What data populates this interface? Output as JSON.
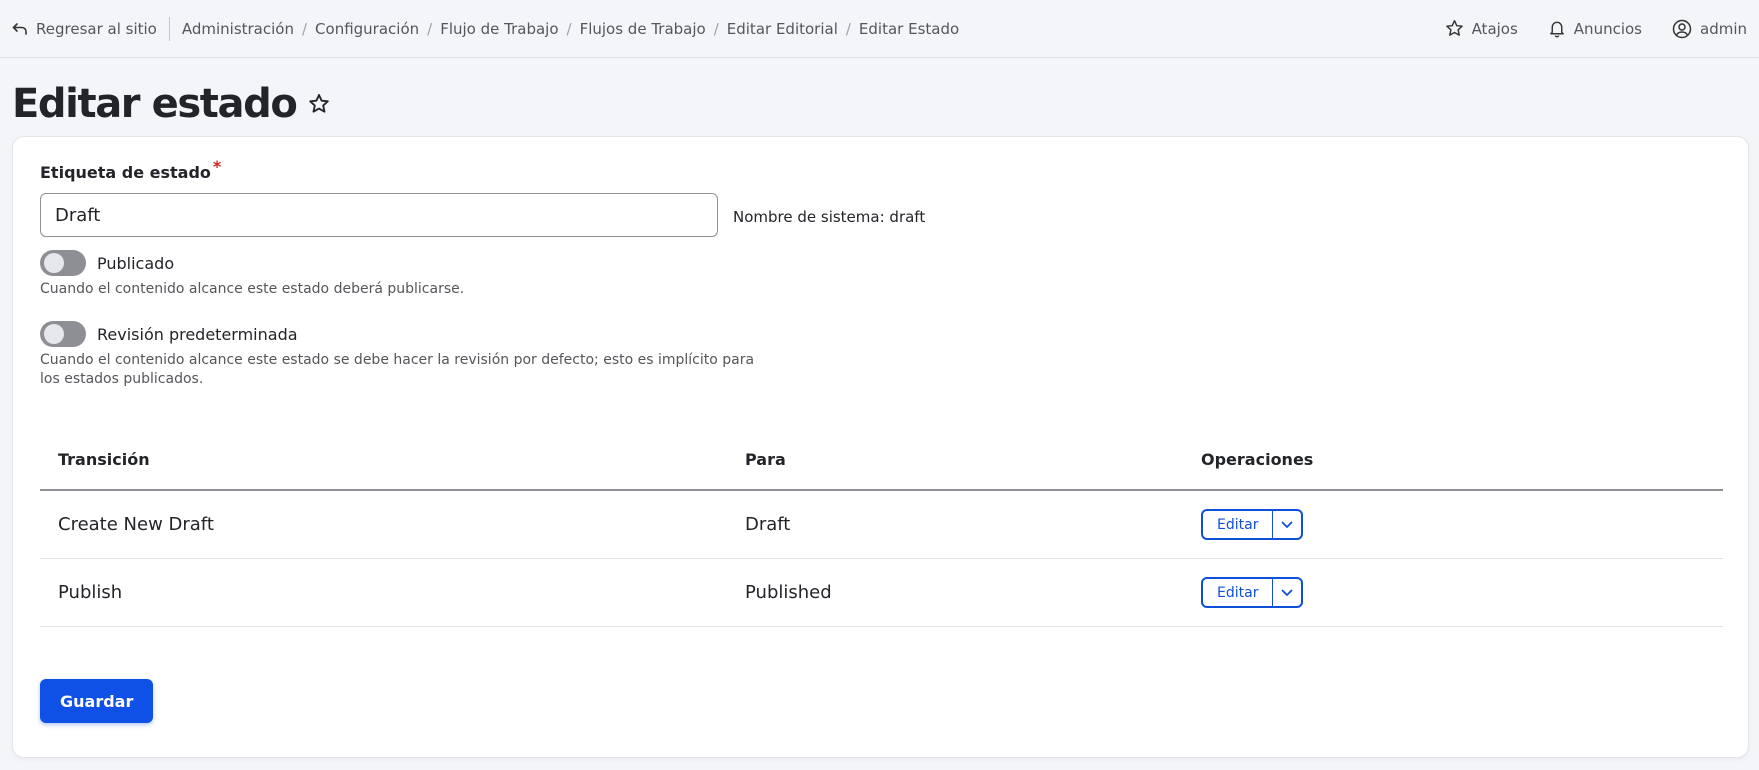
{
  "toolbar": {
    "back_label": "Regresar al sitio",
    "breadcrumbs": [
      "Administración",
      "Configuración",
      "Flujo de Trabajo",
      "Flujos de Trabajo",
      "Editar Editorial",
      "Editar Estado"
    ],
    "shortcuts_label": "Atajos",
    "announcements_label": "Anuncios",
    "user_label": "admin"
  },
  "page": {
    "title": "Editar estado"
  },
  "form": {
    "label_field": {
      "label": "Etiqueta de estado",
      "required_mark": "*",
      "value": "Draft"
    },
    "machine_name": "Nombre de sistema: draft",
    "published": {
      "label": "Publicado",
      "checked": false,
      "help": "Cuando el contenido alcance este estado deberá publicarse."
    },
    "default_revision": {
      "label": "Revisión predeterminada",
      "checked": false,
      "help": "Cuando el contenido alcance este estado se debe hacer la revisión por defecto; esto es implícito para los estados publicados."
    },
    "table": {
      "headers": [
        "Transición",
        "Para",
        "Operaciones"
      ],
      "rows": [
        {
          "transition": "Create New Draft",
          "to": "Draft",
          "operation": "Editar"
        },
        {
          "transition": "Publish",
          "to": "Published",
          "operation": "Editar"
        }
      ]
    },
    "save_label": "Guardar"
  },
  "colors": {
    "primary": "#0f50e6",
    "required": "#d72222"
  }
}
